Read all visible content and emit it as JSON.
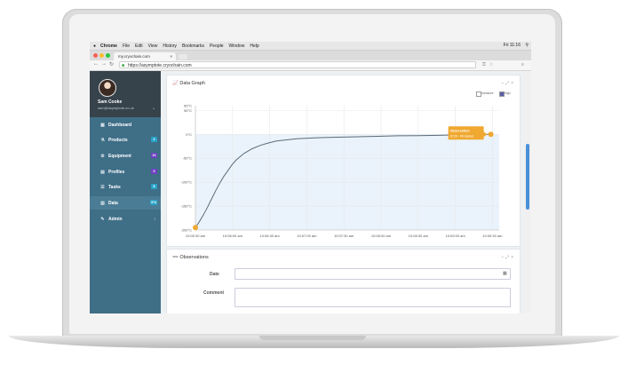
{
  "menubar": {
    "app": "Chrome",
    "items": [
      "File",
      "Edit",
      "View",
      "History",
      "Bookmarks",
      "People",
      "Window",
      "Help"
    ],
    "clock": "Fri 11:16"
  },
  "browser": {
    "tab_title": "my.cryochain.com",
    "url": "https://asymptote.cryochain.com"
  },
  "user": {
    "name": "Sam Cooke",
    "email": "sam@asymptote.co.uk"
  },
  "sidebar": {
    "items": [
      {
        "label": "Dashboard",
        "icon": "dashboard-icon",
        "glyph": "▦",
        "badge": "",
        "badge_color": ""
      },
      {
        "label": "Products",
        "icon": "flask-icon",
        "glyph": "⚗",
        "badge": "2",
        "badge_color": "#2aa3c8"
      },
      {
        "label": "Equipment",
        "icon": "gear-icon",
        "glyph": "⚙",
        "badge": "10",
        "badge_color": "#6f42c1"
      },
      {
        "label": "Profiles",
        "icon": "document-icon",
        "glyph": "▤",
        "badge": "5",
        "badge_color": "#6f42c1"
      },
      {
        "label": "Tasks",
        "icon": "checklist-icon",
        "glyph": "☰",
        "badge": "8",
        "badge_color": "#2aa3c8"
      },
      {
        "label": "Data",
        "icon": "bar-chart-icon",
        "glyph": "▥",
        "badge": "974",
        "badge_color": "#2aa3c8"
      },
      {
        "label": "Admin",
        "icon": "wrench-icon",
        "glyph": "✎",
        "badge": "",
        "badge_color": ""
      }
    ],
    "active_index": 5
  },
  "graph_panel": {
    "title": "Data Graph",
    "legend": [
      "measure",
      "high"
    ]
  },
  "chart_data": {
    "type": "line",
    "title": "",
    "xlabel": "",
    "ylabel": "",
    "x_tick_labels": [
      "10:05:30 am",
      "10:06:00 am",
      "10:06:30 am",
      "10:07:00 am",
      "10:07:30 am",
      "10:08:00 am",
      "10:08:30 am",
      "10:09:00 am",
      "10:09:30 am"
    ],
    "y_tick_labels": [
      "-200°C",
      "-150°C",
      "-100°C",
      "-50°C",
      "0°C",
      "50°C",
      "60°C"
    ],
    "ylim": [
      -200,
      60
    ],
    "grid": true,
    "series": [
      {
        "color": "#5a6b7a",
        "x_seconds": [
          0,
          6,
          12,
          18,
          24,
          30,
          36,
          42,
          48,
          54,
          60,
          72,
          84,
          96,
          108,
          120,
          150,
          180,
          210,
          240,
          270,
          300,
          330,
          360,
          390,
          420,
          435
        ],
        "values": [
          -195,
          -182,
          -168,
          -152,
          -135,
          -118,
          -102,
          -88,
          -76,
          -64,
          -54,
          -40,
          -30,
          -23,
          -18,
          -14,
          -9,
          -7,
          -6,
          -5,
          -4,
          -3,
          -2.5,
          -2,
          -1,
          -0.5,
          0
        ]
      }
    ],
    "annotations": [
      {
        "label": "Observation",
        "sublabel": "10:09 - Fill started",
        "x_seconds": 435,
        "y": 0,
        "color": "#f0a830"
      }
    ],
    "start_marker": {
      "x_seconds": 0,
      "y": -195,
      "color": "#f0a830"
    }
  },
  "observations_panel": {
    "title": "Observations",
    "date_label": "Date",
    "comment_label": "Comment",
    "date_value": "",
    "comment_value": ""
  }
}
